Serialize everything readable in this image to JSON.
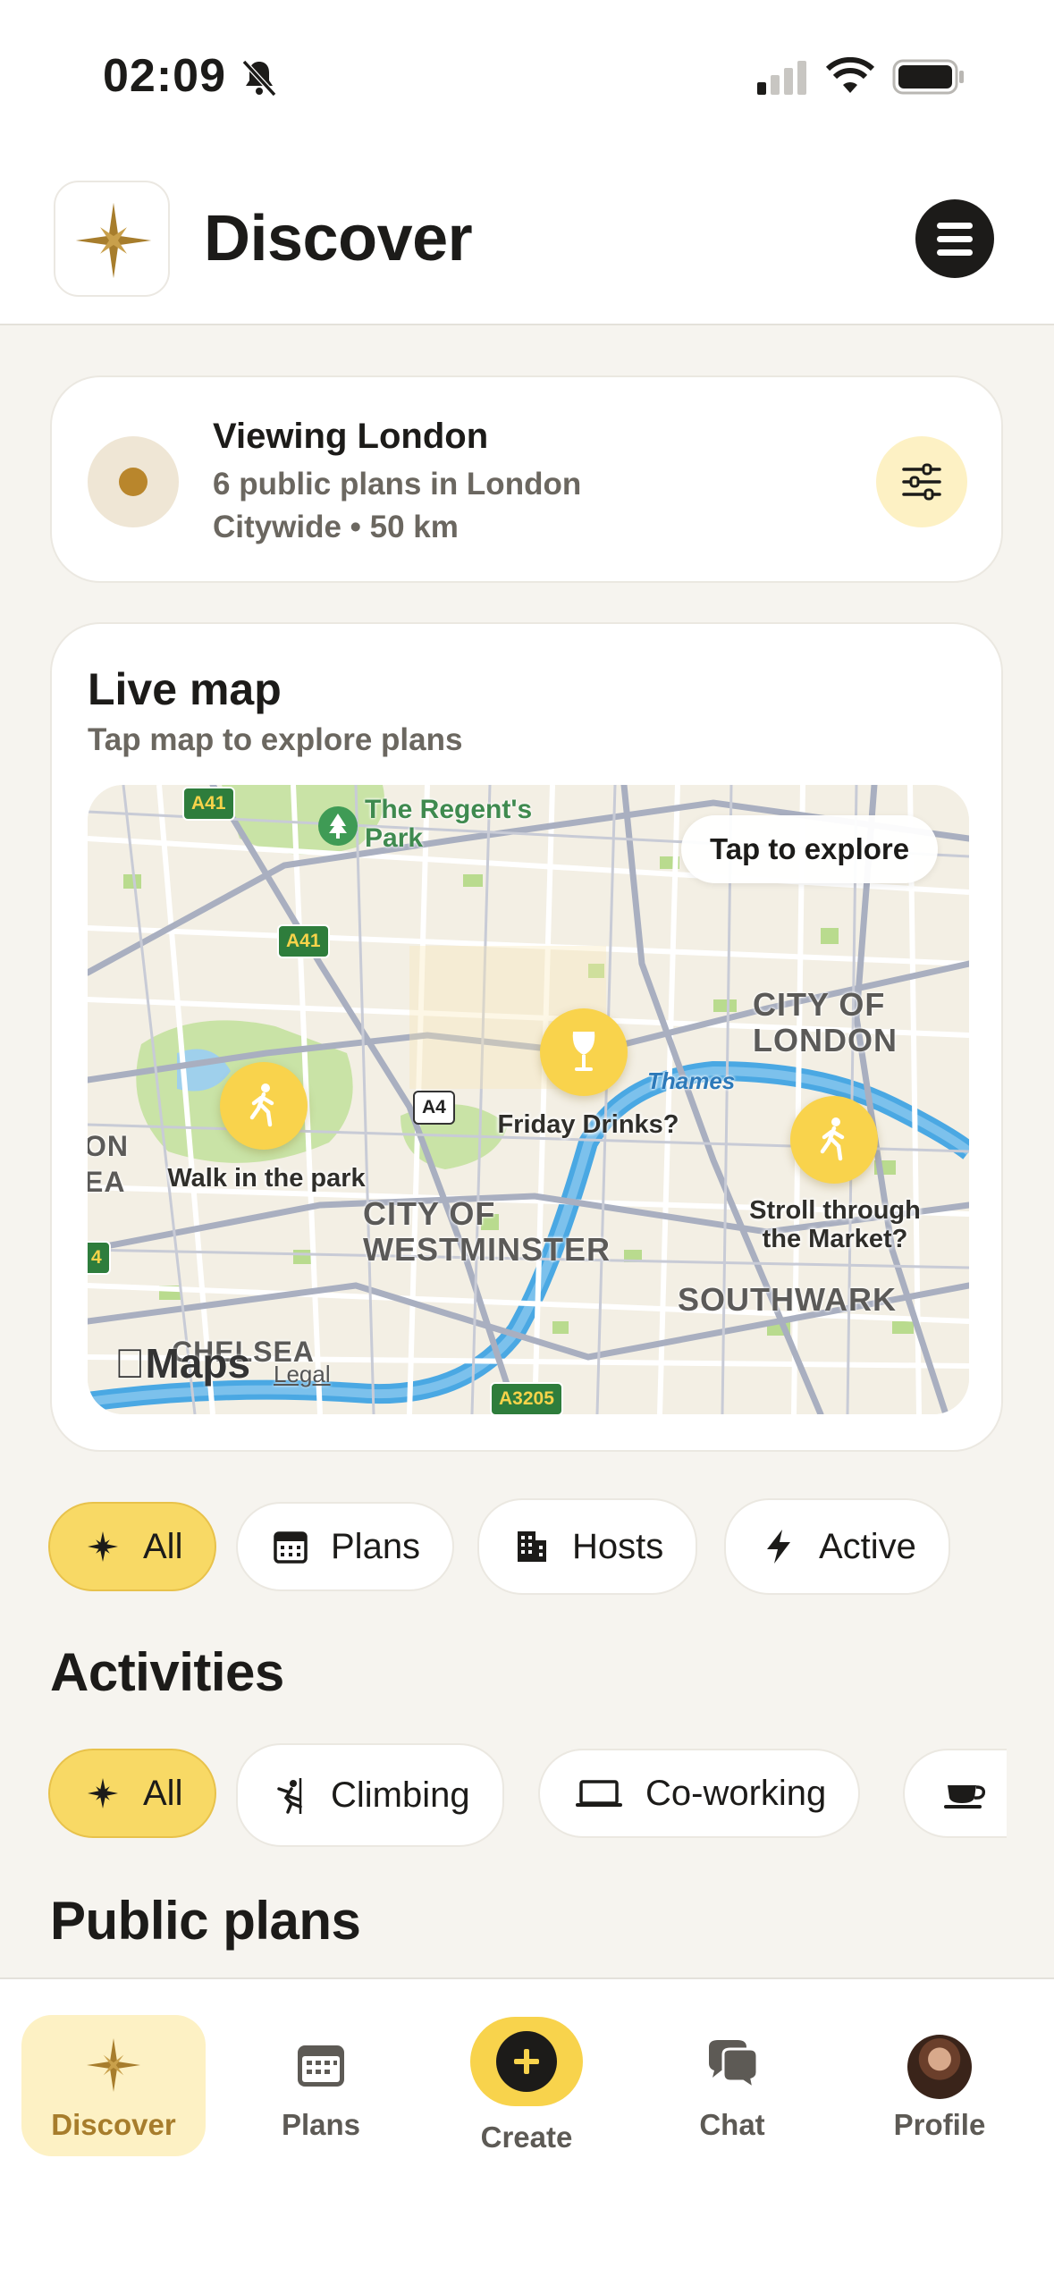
{
  "status_bar": {
    "time": "02:09"
  },
  "header": {
    "title": "Discover"
  },
  "location": {
    "title": "Viewing London",
    "plans_count": "6 public plans in London",
    "radius": "Citywide • 50 km"
  },
  "live_map": {
    "title": "Live map",
    "subtitle": "Tap map to explore plans",
    "explore_label": "Tap to explore",
    "pins": [
      {
        "label": "Walk in the park",
        "icon": "walking-icon"
      },
      {
        "label": "Friday Drinks?",
        "icon": "wine-glass-icon"
      },
      {
        "label": "Stroll through\nthe Market?",
        "icon": "walking-icon"
      }
    ],
    "places": {
      "park": "The Regent's\nPark",
      "city_of_london": "CITY OF\nLONDON",
      "westminster": "CITY OF\nWESTMINSTER",
      "southwark": "SOUTHWARK",
      "chelsea": "CHELSEA",
      "thames": "Thames",
      "left_edge": "ON\nEA"
    },
    "roads": {
      "a41_top": "A41",
      "a41_mid": "A41",
      "a4": "A4",
      "a3205": "A3205",
      "edge": "4"
    },
    "attribution": "Maps",
    "legal": "Legal"
  },
  "filter_chips": [
    {
      "label": "All",
      "icon": "sparkle-icon",
      "selected": true
    },
    {
      "label": "Plans",
      "icon": "calendar-icon",
      "selected": false
    },
    {
      "label": "Hosts",
      "icon": "building-icon",
      "selected": false
    },
    {
      "label": "Active",
      "icon": "bolt-icon",
      "selected": false
    }
  ],
  "activities": {
    "title": "Activities",
    "chips": [
      {
        "label": "All",
        "icon": "sparkle-icon",
        "selected": true
      },
      {
        "label": "Climbing",
        "icon": "climbing-icon",
        "selected": false
      },
      {
        "label": "Co-working",
        "icon": "laptop-icon",
        "selected": false
      },
      {
        "label": "",
        "icon": "coffee-cup-icon",
        "selected": false
      }
    ]
  },
  "public_plans": {
    "title": "Public plans"
  },
  "tab_bar": {
    "discover": "Discover",
    "plans": "Plans",
    "create": "Create",
    "chat": "Chat",
    "profile": "Profile"
  },
  "colors": {
    "accent": "#f8d965",
    "brand_gold": "#a77d2c",
    "background": "#f6f4ef"
  }
}
